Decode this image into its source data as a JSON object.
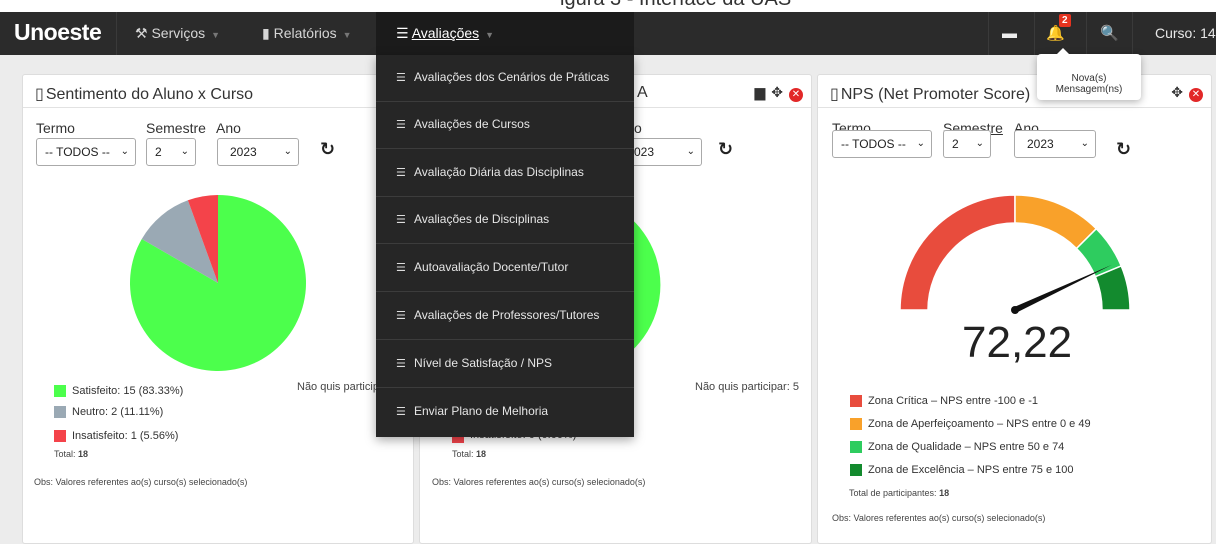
{
  "page_heading_partial": "igura 3 - Interface da UAS",
  "navbar": {
    "brand": "Unoeste",
    "servicos": "Serviços",
    "relatorios": "Relatórios",
    "avaliacoes": "Avaliações",
    "notification_count": "2",
    "curso_label": "Curso: 14"
  },
  "tooltip": "Nova(s) Mensagem(ns)",
  "dropdown": {
    "items": [
      "Avaliações dos Cenários de Práticas",
      "Avaliações de Cursos",
      "Avaliação Diária das Disciplinas",
      "Avaliações de Disciplinas",
      "Autoavaliação Docente/Tutor",
      "Avaliações de Professores/Tutores",
      "Nível de Satisfação / NPS",
      "Enviar Plano de Melhoria"
    ]
  },
  "filters": {
    "termo_label": "Termo",
    "semestre_label": "Semestre",
    "ano_label": "Ano",
    "termo_value": "-- TODOS --",
    "semestre_value": "2",
    "ano_value": "2023"
  },
  "panel1": {
    "title": "Sentimento do Aluno x Curso",
    "legend": [
      {
        "label": "Satisfeito: 15 (83.33%)",
        "color": "#4cff4c"
      },
      {
        "label": "Neutro: 2 (11.11%)",
        "color": "#9aa9b4"
      },
      {
        "label": "Insatisfeito: 1 (5.56%)",
        "color": "#f4434a"
      }
    ],
    "nao_quis": "Não quis particip",
    "total_label": "Total: ",
    "total_value": "18",
    "obs": "Obs: Valores referentes ao(s) curso(s) selecionado(s)"
  },
  "panel2": {
    "title_partial": "A",
    "termo_partial": "o",
    "ano_partial": "023",
    "nao_quis": "Não quis participar: 5",
    "insatisfeito_partial": "Insatisfeito: 0 (0.00%)",
    "total_label": "Total: ",
    "total_value": "18",
    "obs": "Obs: Valores referentes ao(s) curso(s) selecionado(s)"
  },
  "panel3": {
    "title": "NPS (Net Promoter Score)",
    "nps_value": "72,22",
    "legend": [
      {
        "label": "Zona Crítica – NPS entre -100 e -1",
        "color": "#e84c3d"
      },
      {
        "label": "Zona de Aperfeiçoamento – NPS entre 0 e 49",
        "color": "#f9a12a"
      },
      {
        "label": "Zona de Qualidade – NPS entre 50 e 74",
        "color": "#2ecc5f"
      },
      {
        "label": "Zona de Excelência – NPS entre 75 e 100",
        "color": "#138a2e"
      }
    ],
    "total_participantes_label": "Total de participantes: ",
    "total_participantes_value": "18",
    "obs": "Obs: Valores referentes ao(s) curso(s) selecionado(s)"
  },
  "chart_data": [
    {
      "type": "pie",
      "categories": [
        "Satisfeito",
        "Neutro",
        "Insatisfeito"
      ],
      "values": [
        15,
        2,
        1
      ],
      "colors": [
        "#4cff4c",
        "#9aa9b4",
        "#f4434a"
      ]
    },
    {
      "type": "gauge",
      "value": 72.22,
      "range": [
        -100,
        100
      ],
      "bands": [
        {
          "from": -100,
          "to": 0,
          "color": "#e84c3d"
        },
        {
          "from": 0,
          "to": 50,
          "color": "#f9a12a"
        },
        {
          "from": 50,
          "to": 75,
          "color": "#2ecc5f"
        },
        {
          "from": 75,
          "to": 100,
          "color": "#138a2e"
        }
      ]
    }
  ]
}
